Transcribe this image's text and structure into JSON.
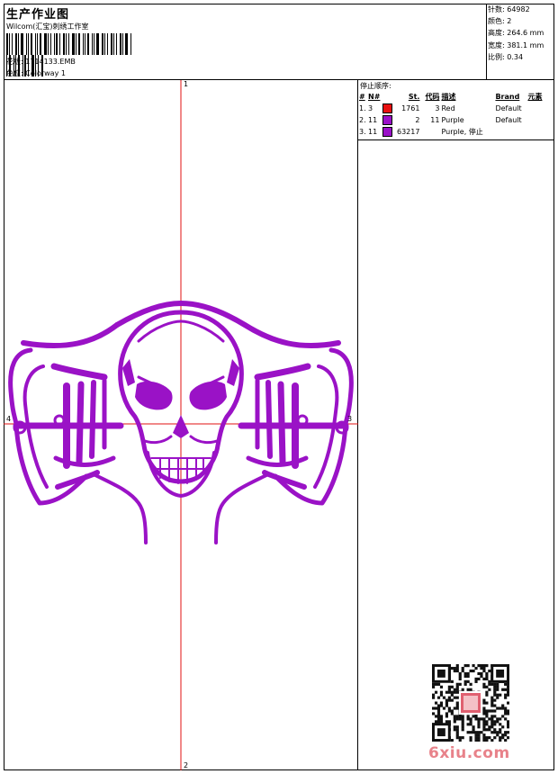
{
  "header": {
    "title": "生产作业图",
    "company": "Wilcom(汇宝)刺绣工作室",
    "design_label": "花版: 1714133.EMB",
    "colorway_label": "色位: Colorway 1"
  },
  "stats": [
    "针数: 64982",
    "颜色: 2",
    "高度: 264.6 mm",
    "宽度: 381.1 mm",
    "比例: 0.34"
  ],
  "stop_sequence": {
    "title": "停止顺序:",
    "headers": [
      "#",
      "N#",
      "St.",
      "代码",
      "描述",
      "Brand",
      "元素"
    ],
    "rows": [
      {
        "idx": "1.",
        "n": "3",
        "color": "#e81010",
        "st": "1761",
        "code": "3",
        "desc": "Red",
        "brand": "Default"
      },
      {
        "idx": "2.",
        "n": "11",
        "color": "#9a10c8",
        "st": "2",
        "code": "11",
        "desc": "Purple",
        "brand": "Default"
      },
      {
        "idx": "3.",
        "n": "11",
        "color": "#9a10c8",
        "st": "63217",
        "code": "",
        "desc": "Purple, 停止",
        "brand": ""
      }
    ]
  },
  "axis_labels": {
    "top": "1",
    "bottom": "2",
    "left": "4",
    "right": "3"
  },
  "colors": {
    "design": "#9a12c6",
    "axis": "#e01010"
  },
  "watermark": "6xiu.com"
}
